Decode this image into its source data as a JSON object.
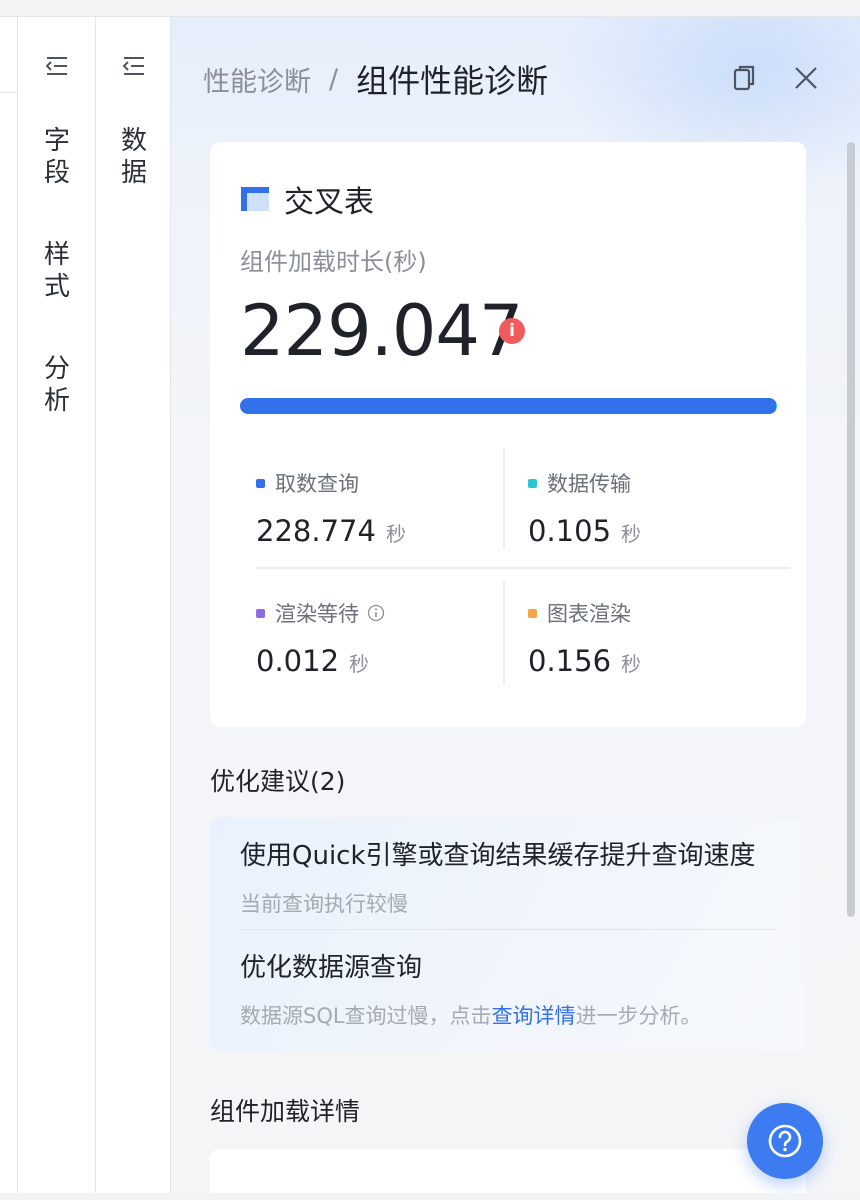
{
  "left_tabs_col1": [
    "字",
    "段",
    "样",
    "式",
    "分",
    "析"
  ],
  "left_tabs_col2": [
    "数",
    "据"
  ],
  "icons": {
    "collapse": "indent-collapse-icon",
    "copy": "copy-icon",
    "close": "close-icon",
    "table": "crosstab-icon",
    "info": "info-icon",
    "help": "help-icon"
  },
  "header": {
    "parent": "性能诊断",
    "separator": "/",
    "current": "组件性能诊断"
  },
  "card": {
    "component_name": "交叉表",
    "metric_label": "组件加载时长(秒)",
    "metric_value": "229.047",
    "info_badge": "i",
    "breakdown": [
      {
        "label": "取数查询",
        "value": "228.774",
        "unit": "秒",
        "color": "#3370eb"
      },
      {
        "label": "数据传输",
        "value": "0.105",
        "unit": "秒",
        "color": "#2ec5d3"
      },
      {
        "label": "渲染等待",
        "value": "0.012",
        "unit": "秒",
        "color": "#8c6ce0"
      },
      {
        "label": "图表渲染",
        "value": "0.156",
        "unit": "秒",
        "color": "#f5a442"
      }
    ]
  },
  "suggestions": {
    "title": "优化建议(2)",
    "items": [
      {
        "title": "使用Quick引擎或查询结果缓存提升查询速度",
        "desc": "当前查询执行较慢"
      },
      {
        "title": "优化数据源查询",
        "desc_prefix": "数据源SQL查询过慢，点击",
        "link": "查询详情",
        "desc_suffix": "进一步分析。"
      }
    ]
  },
  "details": {
    "title": "组件加载详情"
  }
}
